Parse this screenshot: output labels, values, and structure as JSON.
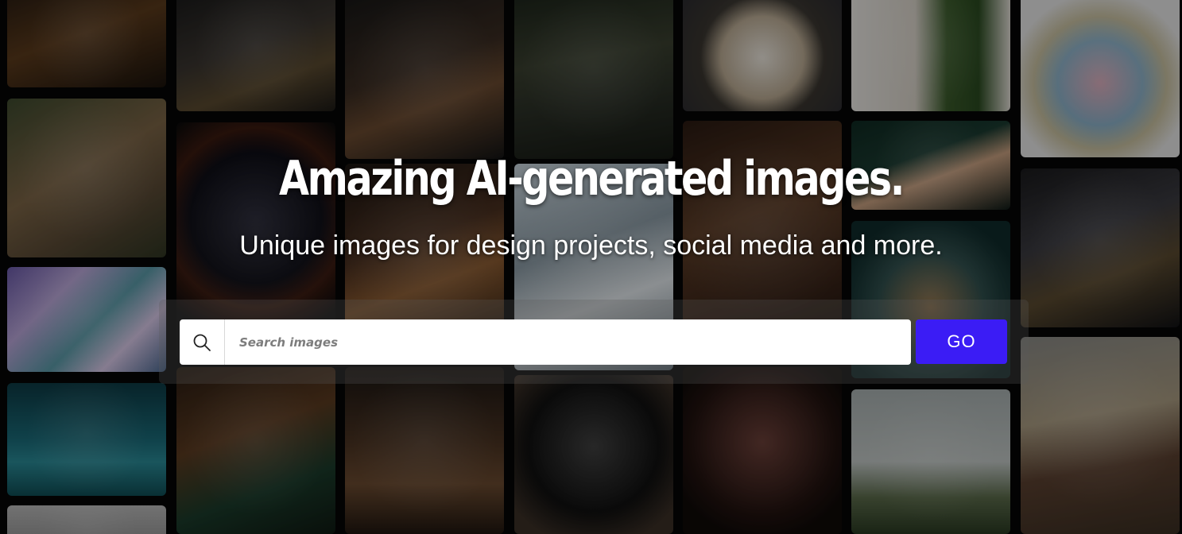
{
  "hero": {
    "headline": "Amazing AI-generated images.",
    "subline": "Unique images for design projects, social media and more."
  },
  "search": {
    "placeholder": "Search images",
    "value": "",
    "go_label": "GO",
    "icon": "search-icon"
  },
  "colors": {
    "accent": "#3b1cf5",
    "background": "#050505"
  },
  "gallery": {
    "images": [
      {
        "name": "gallery-image-steampunk-octopus"
      },
      {
        "name": "gallery-image-bear-painting"
      },
      {
        "name": "gallery-image-geometric-prism"
      },
      {
        "name": "gallery-image-crocodile-water"
      },
      {
        "name": "gallery-image-partial-bottom-left"
      },
      {
        "name": "gallery-image-cat-portrait"
      },
      {
        "name": "gallery-image-astronaut-portal"
      },
      {
        "name": "gallery-image-lion-in-suit"
      },
      {
        "name": "gallery-image-chimp-with-cup"
      },
      {
        "name": "gallery-image-lemur-with-tablet"
      },
      {
        "name": "gallery-image-gothic-castle"
      },
      {
        "name": "gallery-image-otters-sword-fight"
      },
      {
        "name": "gallery-image-futuristic-office"
      },
      {
        "name": "gallery-image-penguin-sunglasses"
      },
      {
        "name": "gallery-image-food-plate"
      },
      {
        "name": "gallery-image-dog-on-armchair"
      },
      {
        "name": "gallery-image-spider-macro"
      },
      {
        "name": "gallery-image-modern-interior"
      },
      {
        "name": "gallery-image-woman-eating"
      },
      {
        "name": "gallery-image-fish-closeup"
      },
      {
        "name": "gallery-image-green-mountain"
      },
      {
        "name": "gallery-image-pastel-rock"
      },
      {
        "name": "gallery-image-knight-at-computer"
      },
      {
        "name": "gallery-image-floating-treehouse"
      }
    ]
  }
}
